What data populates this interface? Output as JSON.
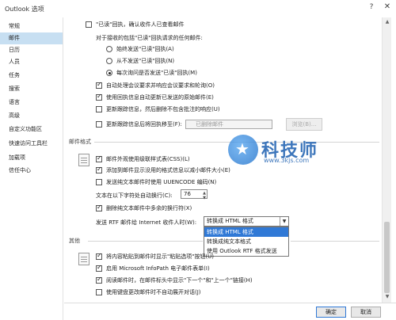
{
  "window": {
    "title": "Outlook 选项",
    "help_icon": "?",
    "close_icon": "✕"
  },
  "sidebar": {
    "items": [
      {
        "label": "常规"
      },
      {
        "label": "邮件"
      },
      {
        "label": "日历"
      },
      {
        "label": "人员"
      },
      {
        "label": "任务"
      },
      {
        "label": "搜索"
      },
      {
        "label": "语言"
      },
      {
        "label": "高级"
      },
      {
        "label": "自定义功能区"
      },
      {
        "label": "快速访问工具栏"
      },
      {
        "label": "加载项"
      },
      {
        "label": "信任中心"
      }
    ],
    "active_index": 1
  },
  "tracking": {
    "always_send_receipt": "\"已读\"回执，确认收件人已查看邮件",
    "request_label": "对于接收的包括\"已读\"回执请求的任何邮件:",
    "radio_always": "始终发送\"已读\"回执(A)",
    "radio_never": "从不发送\"已读\"回执(N)",
    "radio_ask": "每次询问是否发送\"已读\"回执(M)",
    "auto_process": "自动处理会议要求并响应会议要求和轮询(O)",
    "update_original": "使用回执信息自动更新已发送的原始邮件(E)",
    "update_tracking": "更新跟踪信息，然后删除不包含批注的响应(U)",
    "move_receipts": "更新跟踪信息后将回执移至(F):",
    "folder_value": "已删除邮件",
    "browse_button": "浏览(B)..."
  },
  "format": {
    "header": "邮件格式",
    "use_css": "邮件外观使用级联样式表(CSS)(L)",
    "reduce_size": "添加到邮件显示没用的格式信息以减小邮件大小(E)",
    "uuencode": "发送纯文本邮件时使用 UUENCODE 编码(N)",
    "wrap_label": "文本在以下字符处自动换行(C):",
    "wrap_value": "76",
    "remove_breaks": "删除纯文本邮件中多余的换行符(X)",
    "rtf_label": "发送 RTF 邮件给 Internet 收件人时(W):",
    "rtf_selected": "转换成 HTML 格式",
    "rtf_options": [
      "转换成 HTML 格式",
      "转换成纯文本格式",
      "使用 Outlook RTF 格式发送"
    ],
    "rtf_options_selected_index": 0
  },
  "other": {
    "header": "其他",
    "paste_options": "将内容粘贴到邮件时显示\"粘贴选项\"按钮(U)",
    "infopath": "启用 Microsoft InfoPath 电子邮件表单(I)",
    "show_nav": "阅读邮件时，在邮件标头中显示\"下一个\"和\"上一个\"链接(H)",
    "keyboard_only": "使用键盘更改邮件时不自动展开对话(J)"
  },
  "footer": {
    "ok": "确定",
    "cancel": "取消"
  },
  "watermark": {
    "text": "科技师",
    "url": "www.3kjs.com"
  },
  "colors": {
    "active_nav": "#c7dff2",
    "selection_blue": "#3079d6"
  }
}
